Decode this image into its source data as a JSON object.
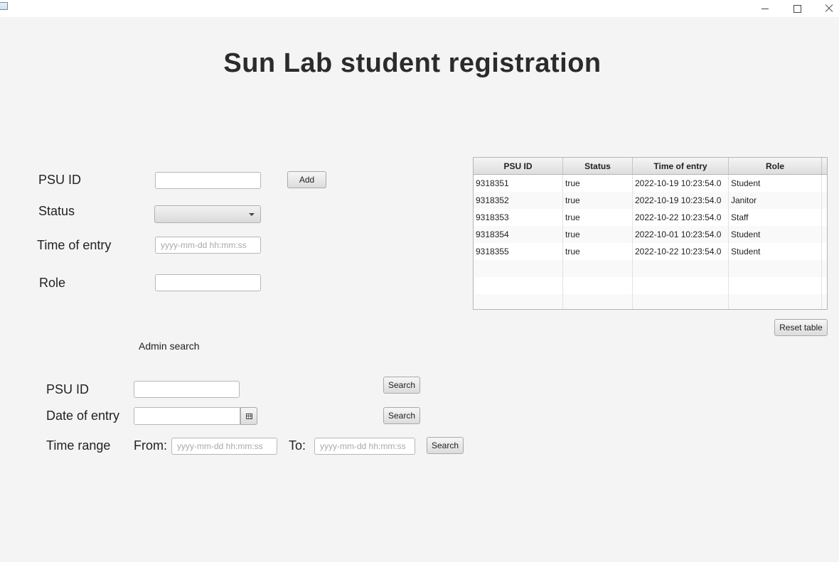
{
  "window": {
    "controls": [
      "minimize-icon",
      "maximize-icon",
      "close-icon"
    ]
  },
  "title": "Sun Lab student registration",
  "registration": {
    "psu_id_label": "PSU ID",
    "status_label": "Status",
    "time_label": "Time of entry",
    "time_placeholder": "yyyy-mm-dd hh:mm:ss",
    "role_label": "Role",
    "add_button": "Add",
    "status_value": ""
  },
  "table": {
    "columns": [
      "PSU ID",
      "Status",
      "Time of entry",
      "Role"
    ],
    "rows": [
      [
        "9318351",
        "true",
        "2022-10-19 10:23:54.0",
        "Student"
      ],
      [
        "9318352",
        "true",
        "2022-10-19 10:23:54.0",
        "Janitor"
      ],
      [
        "9318353",
        "true",
        "2022-10-22 10:23:54.0",
        "Staff"
      ],
      [
        "9318354",
        "true",
        "2022-10-01 10:23:54.0",
        "Student"
      ],
      [
        "9318355",
        "true",
        "2022-10-22 10:23:54.0",
        "Student"
      ],
      [
        "",
        "",
        "",
        ""
      ],
      [
        "",
        "",
        "",
        ""
      ],
      [
        "",
        "",
        "",
        ""
      ]
    ],
    "reset_button": "Reset table"
  },
  "admin": {
    "heading": "Admin search",
    "psu_id_label": "PSU ID",
    "date_label": "Date of entry",
    "time_range_label": "Time range",
    "from_label": "From:",
    "to_label": "To:",
    "from_placeholder": "yyyy-mm-dd hh:mm:ss",
    "to_placeholder": "yyyy-mm-dd hh:mm:ss",
    "search_button": "Search"
  }
}
